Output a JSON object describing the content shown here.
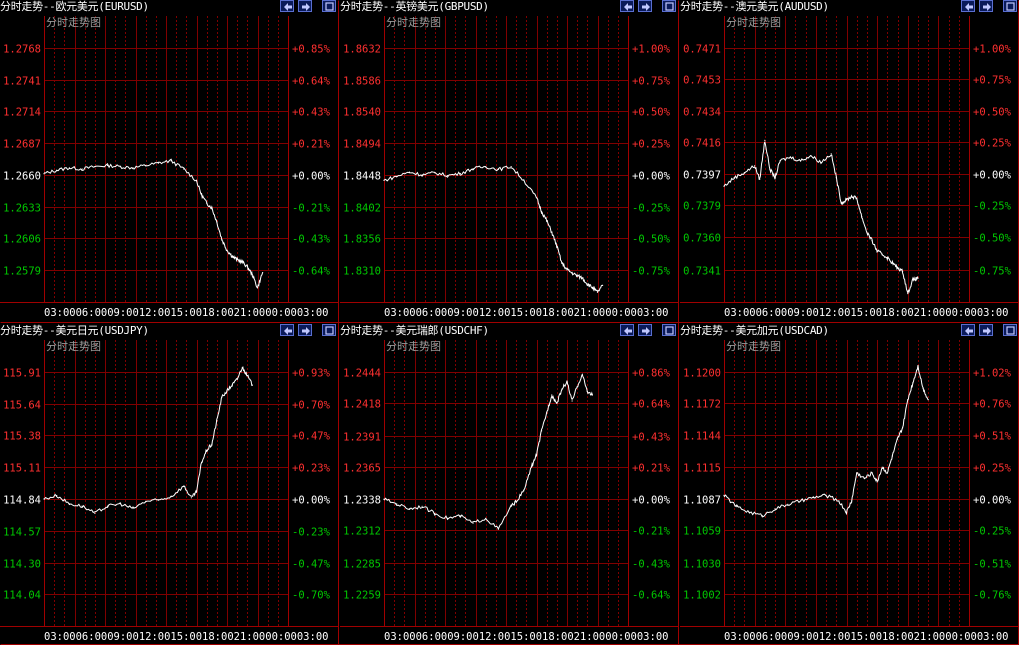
{
  "colors": {
    "background": "#000000",
    "grid": "#800000",
    "frame": "#a00000",
    "price_up": "#ff3030",
    "price_flat": "#ffffff",
    "price_down": "#00c800",
    "line": "#ffffff",
    "subtitle": "#9a9a9a"
  },
  "buttons": {
    "prev_icon": "arrow-left-icon",
    "next_icon": "arrow-right-icon",
    "max_icon": "maximize-icon"
  },
  "chart_data": [
    {
      "type": "line",
      "title": "分时走势--欧元美元(EURUSD)",
      "subtitle": "分时走势图",
      "y_labels": [
        "1.2768",
        "1.2741",
        "1.2714",
        "1.2687",
        "1.2660",
        "1.2633",
        "1.2606",
        "1.2579"
      ],
      "pct_labels": [
        "+0.85%",
        "+0.64%",
        "+0.43%",
        "+0.21%",
        "+0.00%",
        "-0.21%",
        "-0.43%",
        "-0.64%"
      ],
      "ylim": [
        1.2552,
        1.2795
      ],
      "x_labels": [
        "03:00",
        "06:00",
        "09:00",
        "12:00",
        "15:00",
        "18:00",
        "21:00",
        "00:00",
        "03:00"
      ],
      "series": [
        {
          "x": [
            0,
            5,
            10,
            15,
            20,
            25,
            30,
            35,
            40,
            45,
            50,
            55,
            60,
            62,
            64,
            66,
            68,
            70,
            72,
            74,
            76,
            78,
            80,
            82,
            84,
            86
          ],
          "values": [
            1.2661,
            1.2664,
            1.2666,
            1.2665,
            1.2667,
            1.2668,
            1.2667,
            1.2666,
            1.2668,
            1.267,
            1.2672,
            1.2665,
            1.2655,
            1.2643,
            1.2636,
            1.2632,
            1.262,
            1.2605,
            1.2596,
            1.2591,
            1.2588,
            1.2586,
            1.2582,
            1.2575,
            1.2564,
            1.2577
          ]
        }
      ]
    },
    {
      "type": "line",
      "title": "分时走势--英镑美元(GBPUSD)",
      "subtitle": "分时走势图",
      "y_labels": [
        "1.8632",
        "1.8586",
        "1.8540",
        "1.8494",
        "1.8448",
        "1.8402",
        "1.8356",
        "1.8310"
      ],
      "pct_labels": [
        "+1.00%",
        "+0.75%",
        "+0.50%",
        "+0.25%",
        "+0.00%",
        "-0.25%",
        "-0.50%",
        "-0.75%"
      ],
      "ylim": [
        1.8264,
        1.8678
      ],
      "x_labels": [
        "03:00",
        "06:00",
        "09:00",
        "12:00",
        "15:00",
        "18:00",
        "21:00",
        "00:00",
        "03:00"
      ],
      "series": [
        {
          "x": [
            0,
            5,
            10,
            15,
            20,
            25,
            30,
            35,
            40,
            45,
            50,
            55,
            60,
            62,
            64,
            66,
            68,
            70,
            72,
            74,
            76,
            78,
            80,
            82,
            84,
            86
          ],
          "values": [
            1.844,
            1.8446,
            1.8452,
            1.8448,
            1.8451,
            1.8447,
            1.845,
            1.8457,
            1.846,
            1.8456,
            1.846,
            1.844,
            1.8415,
            1.8395,
            1.8382,
            1.8365,
            1.8345,
            1.832,
            1.8311,
            1.8306,
            1.8302,
            1.8299,
            1.829,
            1.8285,
            1.8278,
            1.8288
          ]
        }
      ]
    },
    {
      "type": "line",
      "title": "分时走势--澳元美元(AUDUSD)",
      "subtitle": "分时走势图",
      "y_labels": [
        "0.7471",
        "0.7453",
        "0.7434",
        "0.7416",
        "0.7397",
        "0.7379",
        "0.7360",
        "0.7341"
      ],
      "pct_labels": [
        "+1.00%",
        "+0.75%",
        "+0.50%",
        "+0.25%",
        "+0.00%",
        "-0.25%",
        "-0.50%",
        "-0.75%"
      ],
      "ylim": [
        0.7322,
        0.749
      ],
      "x_labels": [
        "03:00",
        "06:00",
        "09:00",
        "12:00",
        "15:00",
        "18:00",
        "21:00",
        "00:00",
        "03:00"
      ],
      "series": [
        {
          "x": [
            0,
            4,
            8,
            12,
            14,
            16,
            18,
            20,
            22,
            26,
            30,
            34,
            38,
            42,
            44,
            46,
            48,
            50,
            52,
            54,
            56,
            58,
            60,
            62,
            64,
            66,
            68,
            70,
            72,
            74,
            76
          ],
          "values": [
            0.739,
            0.7395,
            0.7398,
            0.7402,
            0.7394,
            0.7417,
            0.74,
            0.7395,
            0.7405,
            0.7407,
            0.7405,
            0.7408,
            0.7404,
            0.7409,
            0.7395,
            0.738,
            0.7382,
            0.7384,
            0.7383,
            0.7372,
            0.7363,
            0.7358,
            0.7352,
            0.735,
            0.7348,
            0.7345,
            0.7342,
            0.734,
            0.7327,
            0.7335,
            0.7336
          ]
        }
      ]
    },
    {
      "type": "line",
      "title": "分时走势--美元日元(USDJPY)",
      "subtitle": "分时走势图",
      "y_labels": [
        "115.91",
        "115.64",
        "115.38",
        "115.11",
        "114.84",
        "114.57",
        "114.30",
        "114.04"
      ],
      "pct_labels": [
        "+0.93%",
        "+0.70%",
        "+0.47%",
        "+0.23%",
        "+0.00%",
        "-0.23%",
        "-0.47%",
        "-0.70%"
      ],
      "ylim": [
        113.77,
        116.18
      ],
      "x_labels": [
        "03:00",
        "06:00",
        "09:00",
        "12:00",
        "15:00",
        "18:00",
        "21:00",
        "00:00",
        "03:00"
      ],
      "series": [
        {
          "x": [
            0,
            5,
            10,
            15,
            20,
            25,
            30,
            35,
            40,
            45,
            50,
            55,
            58,
            60,
            62,
            64,
            66,
            68,
            70,
            72,
            74,
            76,
            78,
            80,
            82
          ],
          "values": [
            114.84,
            114.87,
            114.8,
            114.78,
            114.72,
            114.78,
            114.8,
            114.76,
            114.82,
            114.83,
            114.86,
            114.95,
            114.85,
            114.9,
            115.15,
            115.25,
            115.3,
            115.5,
            115.7,
            115.75,
            115.8,
            115.85,
            115.95,
            115.88,
            115.8
          ]
        }
      ]
    },
    {
      "type": "line",
      "title": "分时走势--美元瑞郎(USDCHF)",
      "subtitle": "分时走势图",
      "y_labels": [
        "1.2444",
        "1.2418",
        "1.2391",
        "1.2365",
        "1.2338",
        "1.2312",
        "1.2285",
        "1.2259"
      ],
      "pct_labels": [
        "+0.86%",
        "+0.64%",
        "+0.43%",
        "+0.21%",
        "+0.00%",
        "-0.21%",
        "-0.43%",
        "-0.64%"
      ],
      "ylim": [
        1.2232,
        1.2471
      ],
      "x_labels": [
        "03:00",
        "06:00",
        "09:00",
        "12:00",
        "15:00",
        "18:00",
        "21:00",
        "00:00",
        "03:00"
      ],
      "series": [
        {
          "x": [
            0,
            5,
            10,
            15,
            20,
            25,
            30,
            35,
            40,
            45,
            50,
            52,
            55,
            58,
            60,
            62,
            64,
            66,
            68,
            70,
            72,
            74,
            76,
            78,
            80,
            82
          ],
          "values": [
            1.2338,
            1.2334,
            1.233,
            1.2332,
            1.2326,
            1.2322,
            1.2324,
            1.2318,
            1.2322,
            1.2313,
            1.2332,
            1.2336,
            1.2345,
            1.2365,
            1.2375,
            1.2395,
            1.241,
            1.2425,
            1.2418,
            1.243,
            1.2436,
            1.242,
            1.2432,
            1.2442,
            1.2428,
            1.2425
          ]
        }
      ]
    },
    {
      "type": "line",
      "title": "分时走势--美元加元(USDCAD)",
      "subtitle": "分时走势图",
      "y_labels": [
        "1.1200",
        "1.1172",
        "1.1144",
        "1.1115",
        "1.1087",
        "1.1059",
        "1.1030",
        "1.1002"
      ],
      "pct_labels": [
        "+1.02%",
        "+0.76%",
        "+0.51%",
        "+0.25%",
        "+0.00%",
        "-0.25%",
        "-0.51%",
        "-0.76%"
      ],
      "ylim": [
        1.0974,
        1.1228
      ],
      "x_labels": [
        "03:00",
        "06:00",
        "09:00",
        "12:00",
        "15:00",
        "18:00",
        "21:00",
        "00:00",
        "03:00"
      ],
      "series": [
        {
          "x": [
            0,
            5,
            10,
            15,
            20,
            25,
            30,
            35,
            40,
            45,
            48,
            50,
            52,
            55,
            58,
            60,
            62,
            64,
            66,
            68,
            70,
            72,
            74,
            76,
            78,
            80
          ],
          "values": [
            1.109,
            1.108,
            1.1075,
            1.1072,
            1.1078,
            1.1082,
            1.1085,
            1.1088,
            1.109,
            1.1085,
            1.1075,
            1.1085,
            1.111,
            1.1105,
            1.111,
            1.1102,
            1.1115,
            1.111,
            1.1125,
            1.114,
            1.115,
            1.1175,
            1.119,
            1.1205,
            1.1185,
            1.1175
          ]
        }
      ]
    }
  ]
}
